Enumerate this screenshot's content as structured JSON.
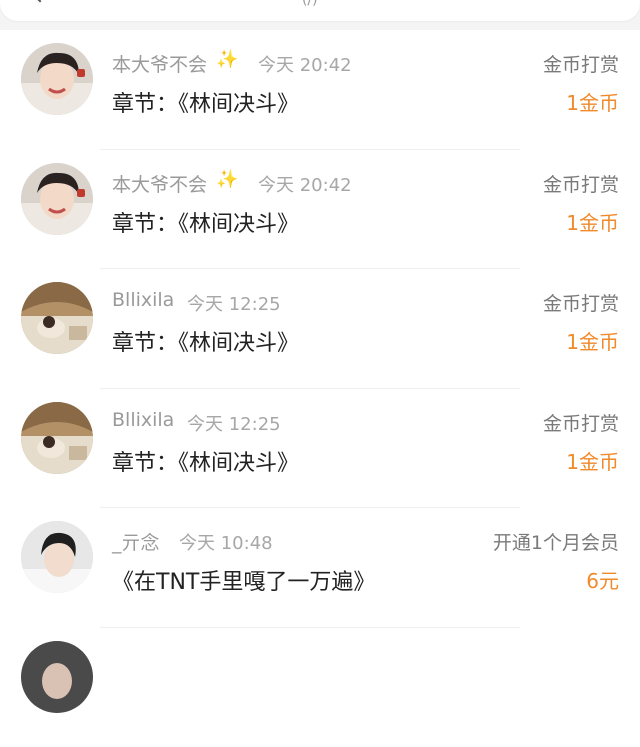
{
  "header": {
    "back_icon": "chevron-left-icon",
    "center_glyph": "(/)"
  },
  "colors": {
    "accent": "#f08a2a",
    "secondary_text": "#9a9a9a",
    "sparkle": "#f2c94c"
  },
  "items": [
    {
      "user": "本大爷不会",
      "sparkle": "✨",
      "time": "今天 20:42",
      "content": "章节：《林间决斗》",
      "action": "金币打赏",
      "amount": "1金币",
      "avatar": "boy-red"
    },
    {
      "user": "本大爷不会",
      "sparkle": "✨",
      "time": "今天 20:42",
      "content": "章节：《林间决斗》",
      "action": "金币打赏",
      "amount": "1金币",
      "avatar": "boy-red"
    },
    {
      "user": "Bllixila",
      "sparkle": "",
      "time": "今天 12:25",
      "content": "章节：《林间决斗》",
      "action": "金币打赏",
      "amount": "1金币",
      "avatar": "room-girl"
    },
    {
      "user": "Bllixila",
      "sparkle": "",
      "time": "今天 12:25",
      "content": "章节：《林间决斗》",
      "action": "金币打赏",
      "amount": "1金币",
      "avatar": "room-girl"
    },
    {
      "user": "_亓念",
      "sparkle": "",
      "time": "今天 10:48",
      "content": "《在TNT手里嘎了一万遍》",
      "action": "开通1个月会员",
      "amount": "6元",
      "avatar": "boy-white"
    },
    {
      "user": "",
      "sparkle": "",
      "time": "",
      "content": "",
      "action": "",
      "amount": "",
      "avatar": "boy-dark"
    }
  ]
}
